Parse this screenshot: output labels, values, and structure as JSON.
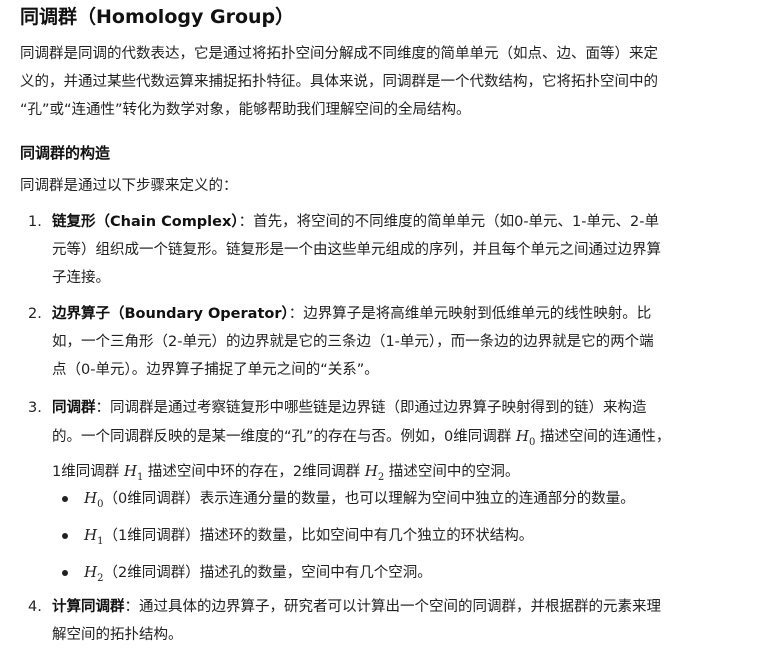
{
  "title": "同调群（Homology Group）",
  "intro": {
    "line1": "同调群是同调的代数表达，它是通过将拓扑空间分解成不同维度的简单单元（如点、边、面等）来定",
    "line2": "义的，并通过某些代数运算来捕捉拓扑特征。具体来说，同调群是一个代数结构，它将拓扑空间中的",
    "line3": "“孔”或“连通性”转化为数学对象，能够帮助我们理解空间的全局结构。"
  },
  "section_heading": "同调群的构造",
  "section_lead": "同调群是通过以下步骤来定义的：",
  "steps": [
    {
      "number": "1.",
      "term": "链复形（Chain Complex）",
      "line1": "：首先，将空间的不同维度的简单单元（如0-单元、1-单元、2-单",
      "line2": "元等）组织成一个链复形。链复形是一个由这些单元组成的序列，并且每个单元之间通过边界算",
      "line3": "子连接。"
    },
    {
      "number": "2.",
      "term": "边界算子（Boundary Operator）",
      "line1": "：边界算子是将高维单元映射到低维单元的线性映射。比",
      "line2": "如，一个三角形（2-单元）的边界就是它的三条边（1-单元），而一条边的边界就是它的两个端",
      "line3": "点（0-单元）。边界算子捕捉了单元之间的“关系”。"
    },
    {
      "number": "3.",
      "term": "同调群",
      "line1": "：同调群是通过考察链复形中哪些链是边界链（即通过边界算子映射得到的链）来构造",
      "line2a": "的。一个同调群反映的是某一维度的“孔”的存在与否。例如，0维同调群",
      "line2b": "描述空间的连通性，",
      "line3a": "1维同调群",
      "line3b": "描述空间中环的存在，2维同调群",
      "line3c": "描述空间中的空洞。"
    },
    {
      "number": "4.",
      "term": "计算同调群",
      "line1": "：通过具体的边界算子，研究者可以计算出一个空间的同调群，并根据群的元素来理",
      "line2": "解空间的拓扑结构。"
    }
  ],
  "math": {
    "H": "H",
    "sub0": "0",
    "sub1": "1",
    "sub2": "2"
  },
  "bullets": [
    {
      "text": "（0维同调群）表示连通分量的数量，也可以理解为空间中独立的连通部分的数量。"
    },
    {
      "text": "（1维同调群）描述环的数量，比如空间中有几个独立的环状结构。"
    },
    {
      "text": "（2维同调群）描述孔的数量，空间中有几个空洞。"
    }
  ]
}
